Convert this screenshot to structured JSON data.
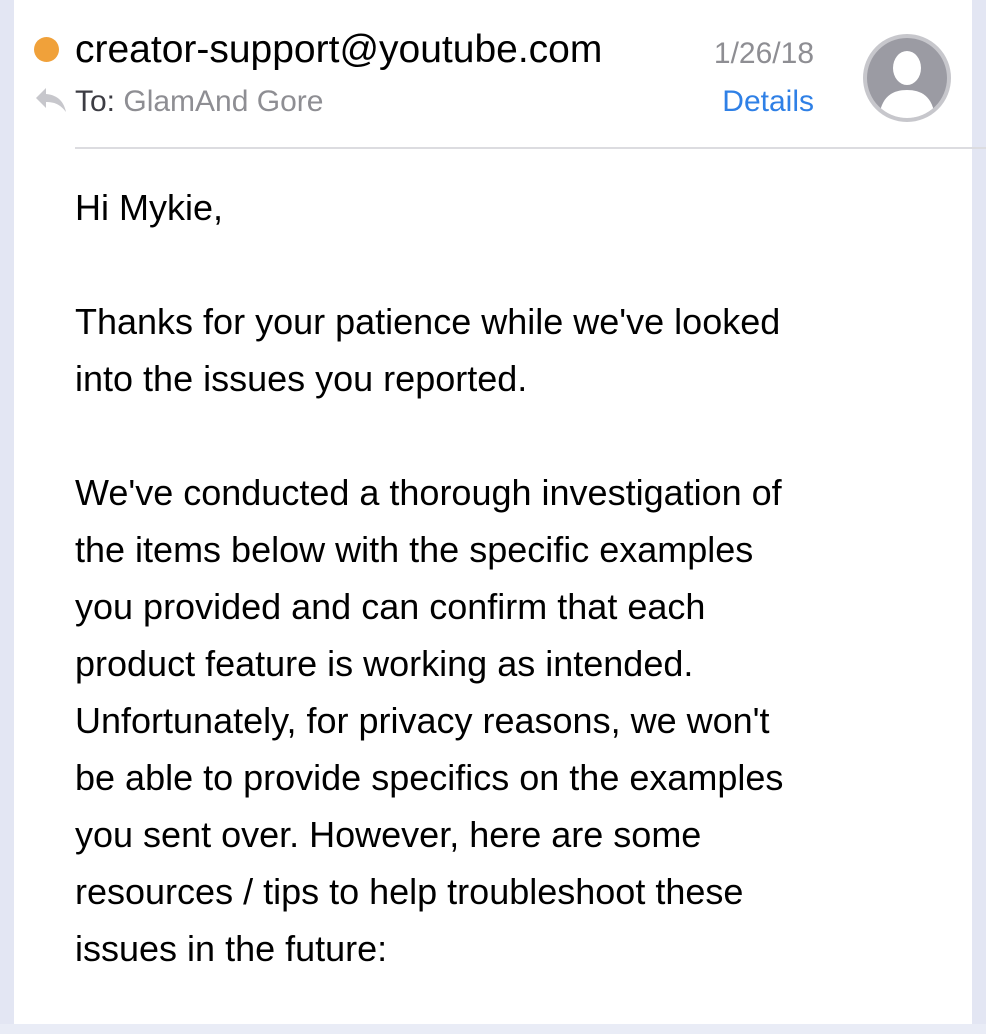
{
  "header": {
    "sender": "creator-support@youtube.com",
    "date": "1/26/18",
    "to_label": "To:",
    "to_value": "GlamAnd Gore",
    "details_label": "Details",
    "unread_color": "#f0a13a",
    "reply_icon": "reply-arrow-icon",
    "avatar_icon": "person-silhouette-icon"
  },
  "body": {
    "paragraphs": [
      "Hi Mykie,",
      "Thanks for your patience while we've looked\ninto the issues you reported.",
      "We've conducted a thorough investigation of\nthe items below with the specific examples\nyou provided and can confirm that each\nproduct feature is working as intended.\nUnfortunately, for privacy reasons, we won't\nbe able to provide specifics on the examples\nyou sent over. However, here are some\nresources / tips to help troubleshoot these\nissues in the future:"
    ]
  }
}
